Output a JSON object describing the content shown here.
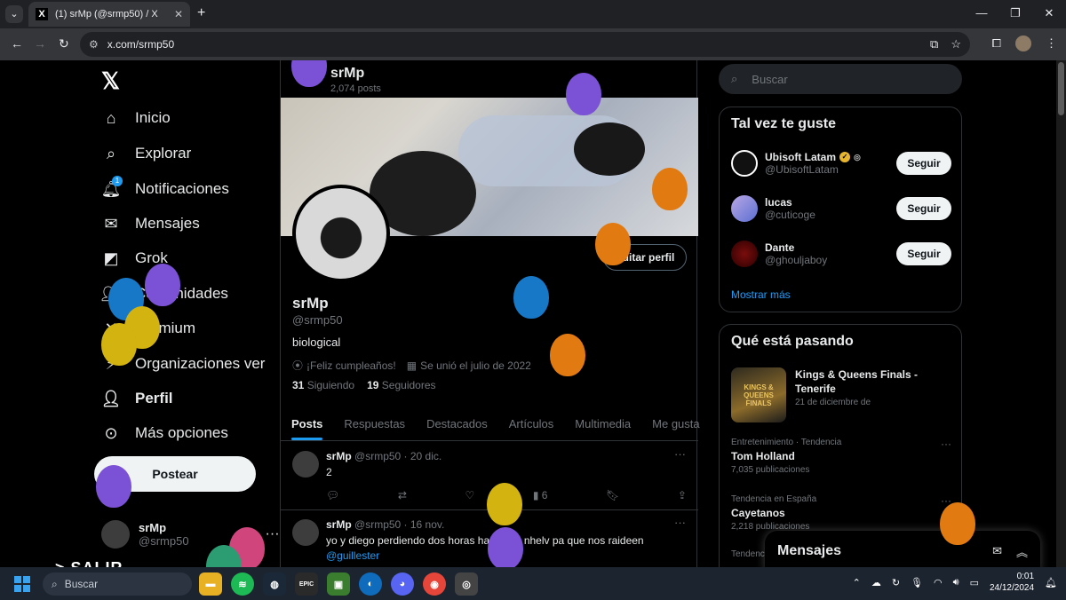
{
  "browser": {
    "tab_title": "(1) srMp (@srmp50) / X",
    "tab_favicon": "X",
    "url": "x.com/srmp50"
  },
  "nav": {
    "logo": "𝕏",
    "items": [
      {
        "label": "Inicio",
        "icon": "home-icon"
      },
      {
        "label": "Explorar",
        "icon": "search-icon"
      },
      {
        "label": "Notificaciones",
        "icon": "bell-icon",
        "badge": "1"
      },
      {
        "label": "Mensajes",
        "icon": "mail-icon"
      },
      {
        "label": "Grok",
        "icon": "grok-icon"
      },
      {
        "label": "Comunidades",
        "icon": "people-icon"
      },
      {
        "label": "Premium",
        "icon": "x-icon"
      },
      {
        "label": "Organizaciones ver",
        "icon": "lightning-icon"
      },
      {
        "label": "Perfil",
        "icon": "person-icon"
      },
      {
        "label": "Más opciones",
        "icon": "more-circle-icon"
      }
    ],
    "post_button": "Postear",
    "account_name": "srMp",
    "account_handle": "@srmp50",
    "overlay_text": "> SALIR"
  },
  "profile": {
    "header_name": "srMp",
    "post_count": "2,074 posts",
    "edit_button": "Editar perfil",
    "name": "srMp",
    "handle": "@srmp50",
    "bio": "biological",
    "birthday": "¡Feliz cumpleaños!",
    "joined": "Se unió el julio de 2022",
    "following_count": "31",
    "following_label": "Siguiendo",
    "followers_count": "19",
    "followers_label": "Seguidores",
    "tabs": [
      "Posts",
      "Respuestas",
      "Destacados",
      "Artículos",
      "Multimedia",
      "Me gusta"
    ]
  },
  "posts": [
    {
      "name": "srMp",
      "meta": "@srmp50 · 20 dic.",
      "text": "2",
      "views": "6"
    },
    {
      "name": "srMp",
      "meta": "@srmp50 · 16 nov.",
      "text": "yo y diego perdiendo dos horas haciendo nhelv pa que nos raideen",
      "link": "@guillester"
    }
  ],
  "sidebar": {
    "search_placeholder": "Buscar",
    "wtf_title": "Tal vez te guste",
    "who_to_follow": [
      {
        "name": "Ubisoft Latam",
        "handle": "@UbisoftLatam",
        "button": "Seguir"
      },
      {
        "name": "lucas",
        "handle": "@cuticoge",
        "button": "Seguir"
      },
      {
        "name": "Dante",
        "handle": "@ghouljaboy",
        "button": "Seguir"
      }
    ],
    "show_more": "Mostrar más",
    "trending_title": "Qué está pasando",
    "event": {
      "title": "Kings & Queens Finals - Tenerife",
      "date": "21 de diciembre de",
      "image_text": "KINGS & QUEENS FINALS"
    },
    "trends": [
      {
        "context": "Entretenimiento · Tendencia",
        "title": "Tom Holland",
        "count": "7,035 publicaciones"
      },
      {
        "context": "Tendencia en España",
        "title": "Cayetanos",
        "count": "2,218 publicaciones"
      },
      {
        "context": "Tendenc",
        "title": "",
        "count": ""
      }
    ],
    "messages_label": "Mensajes"
  },
  "taskbar": {
    "search": "Buscar",
    "time": "0:01",
    "date": "24/12/2024"
  },
  "colors": {
    "accent": "#1d9bf0",
    "background": "#000000",
    "border": "#2f3336",
    "muted": "#71767b"
  }
}
